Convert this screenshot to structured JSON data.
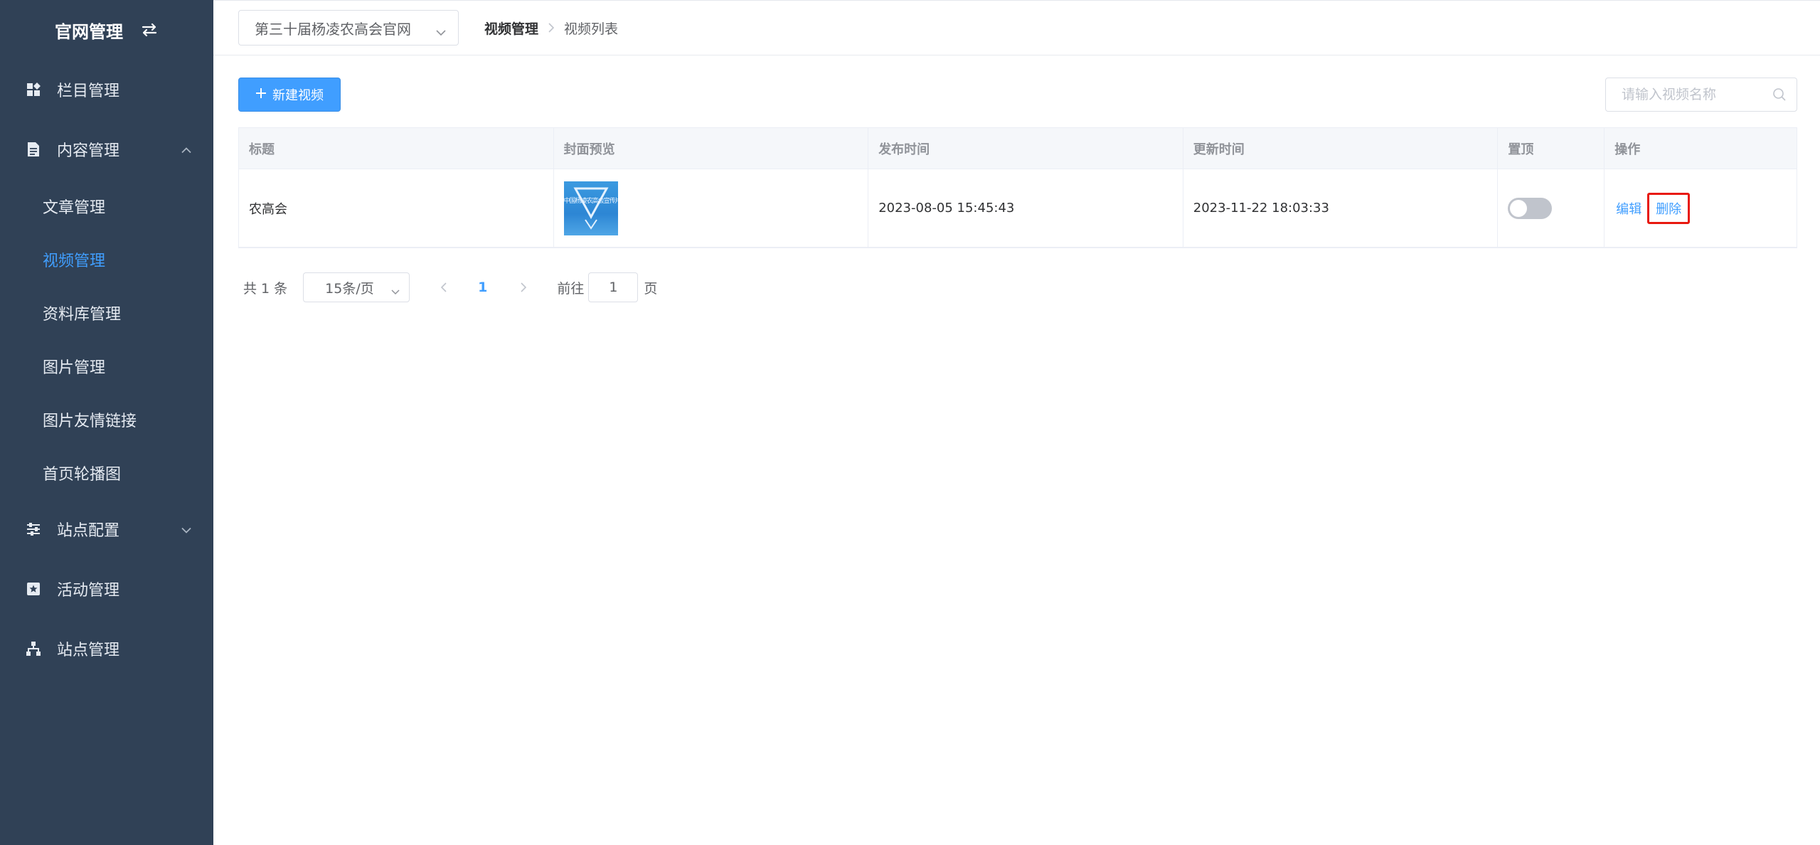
{
  "sidebar": {
    "title": "官网管理",
    "menu": [
      {
        "label": "栏目管理"
      },
      {
        "label": "内容管理",
        "children": [
          "文章管理",
          "视频管理",
          "资料库管理",
          "图片管理",
          "图片友情链接",
          "首页轮播图"
        ]
      },
      {
        "label": "站点配置"
      },
      {
        "label": "活动管理"
      },
      {
        "label": "站点管理"
      }
    ],
    "active_item": "视频管理"
  },
  "topbar": {
    "site_select_value": "第三十届杨凌农高会官网",
    "breadcrumb": [
      "视频管理",
      "视频列表"
    ]
  },
  "toolbar": {
    "new_button_label": "新建视频",
    "search_placeholder": "请输入视频名称"
  },
  "table": {
    "headers": [
      "标题",
      "封面预览",
      "发布时间",
      "更新时间",
      "置顶",
      "操作"
    ],
    "rows": [
      {
        "title": "农高会",
        "cover_caption": "中国杨凌农高会宣传片",
        "published": "2023-08-05 15:45:43",
        "updated": "2023-11-22 18:03:33",
        "pinned": false,
        "actions": {
          "edit": "编辑",
          "delete": "删除"
        }
      }
    ]
  },
  "pagination": {
    "total_text": "共 1 条",
    "page_size": "15条/页",
    "current_page": "1",
    "goto_prefix": "前往",
    "goto_value": "1",
    "goto_suffix": "页"
  },
  "colors": {
    "sidebar_bg": "#304156",
    "primary": "#409eff",
    "highlight_border": "#e8190f",
    "switch_off": "#c0c4cc"
  }
}
